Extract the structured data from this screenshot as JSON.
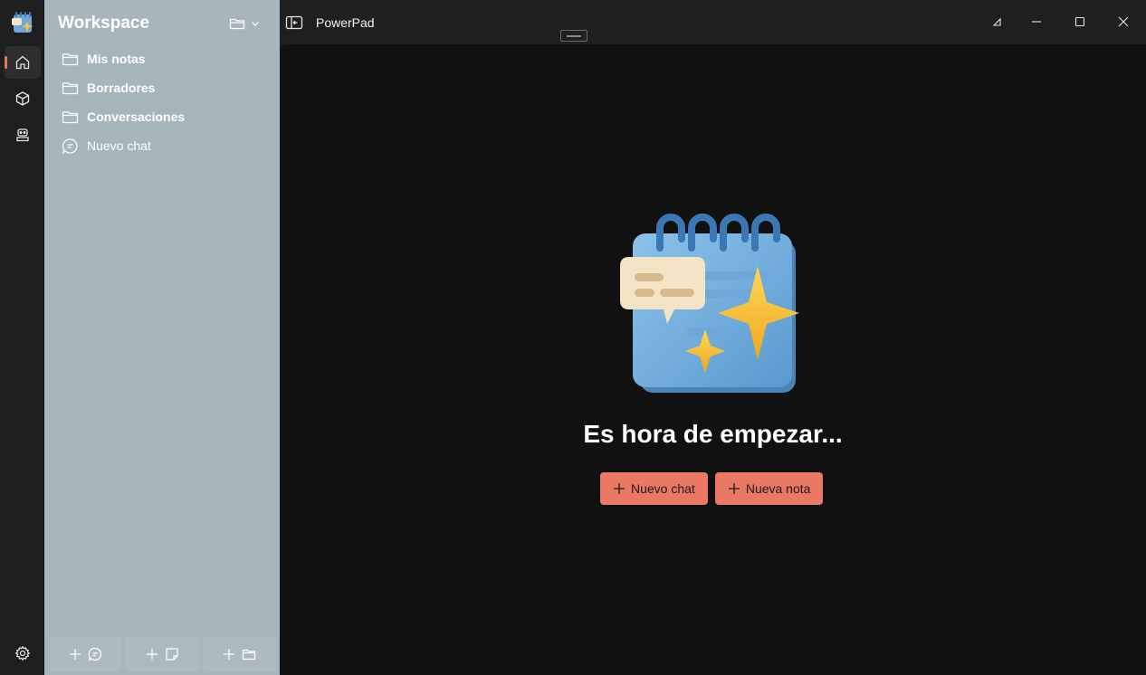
{
  "app": {
    "title": "PowerPad"
  },
  "rail": {
    "items": [
      {
        "icon": "home-icon"
      },
      {
        "icon": "cube-icon"
      },
      {
        "icon": "robot-icon"
      }
    ],
    "settings_icon": "gear-icon"
  },
  "sidebar": {
    "title": "Workspace",
    "items": [
      {
        "label": "Mis notas",
        "kind": "folder"
      },
      {
        "label": "Borradores",
        "kind": "folder"
      },
      {
        "label": "Conversaciones",
        "kind": "folder"
      },
      {
        "label": "Nuevo chat",
        "kind": "chat"
      }
    ],
    "footer": [
      {
        "icon": "new-chat-icon"
      },
      {
        "icon": "new-note-icon"
      },
      {
        "icon": "new-folder-icon"
      }
    ]
  },
  "main": {
    "heading": "Es hora de empezar...",
    "new_chat_label": "Nuevo chat",
    "new_note_label": "Nueva nota"
  },
  "colors": {
    "accent": "#eb7765",
    "sidebar_bg": "#a7b5bd",
    "main_bg": "#111111"
  }
}
